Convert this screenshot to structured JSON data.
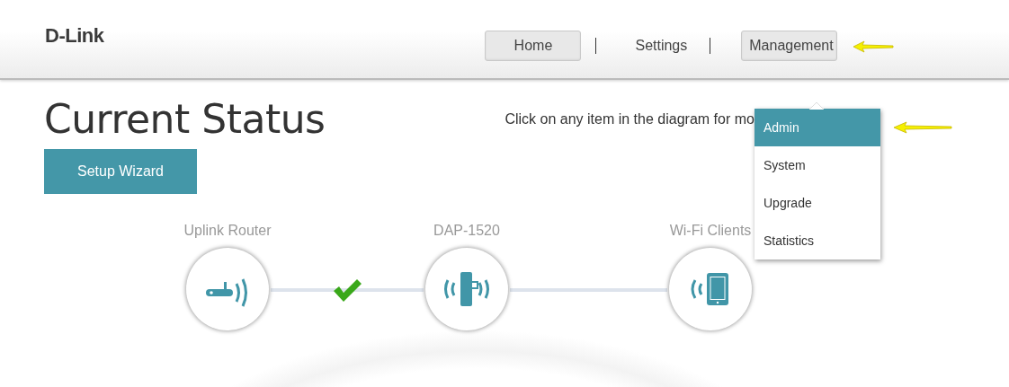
{
  "logo": "D-Link",
  "nav": [
    {
      "label": "Home",
      "selected": true
    },
    {
      "label": "Settings",
      "selected": false
    },
    {
      "label": "Management",
      "selected": true
    }
  ],
  "title": "Current Status",
  "setup_button": "Setup Wizard",
  "hint": "Click on any item in the diagram for mo",
  "menu": [
    {
      "label": "Admin",
      "selected": true
    },
    {
      "label": "System",
      "selected": false
    },
    {
      "label": "Upgrade",
      "selected": false
    },
    {
      "label": "Statistics",
      "selected": false
    }
  ],
  "diagram": {
    "nodes": [
      {
        "kind": "router",
        "label": "Uplink Router"
      },
      {
        "kind": "extender",
        "label": "DAP-1520"
      },
      {
        "kind": "clients",
        "label": "Wi-Fi Clients"
      }
    ],
    "links": [
      {
        "connected": true
      },
      {
        "connected": false
      }
    ]
  }
}
